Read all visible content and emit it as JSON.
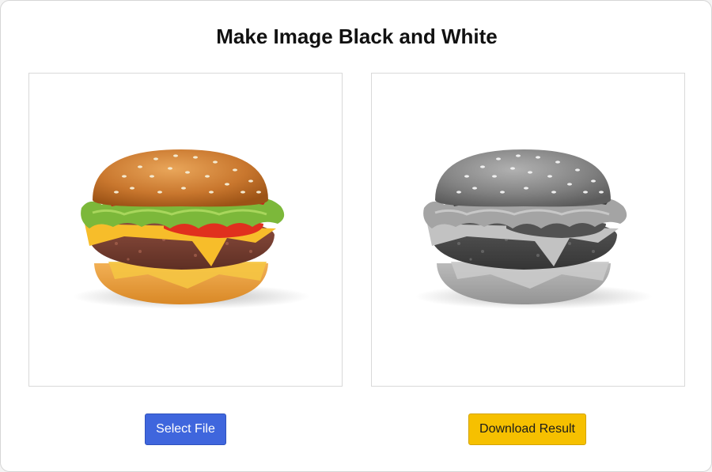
{
  "page": {
    "title": "Make Image Black and White"
  },
  "panels": {
    "original": {
      "image": "burger-color"
    },
    "result": {
      "image": "burger-grayscale"
    }
  },
  "buttons": {
    "select_file_label": "Select File",
    "download_label": "Download Result"
  },
  "colors": {
    "select_button": "#3f66dd",
    "download_button": "#f6c000",
    "background": "#ffffff"
  }
}
